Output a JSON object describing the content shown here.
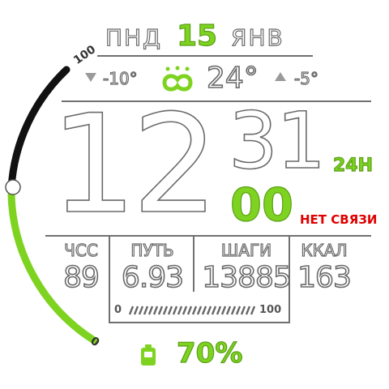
{
  "colors": {
    "accent": "#7ed321",
    "alert": "#e00000",
    "arc_dark": "#111111",
    "outline": "#6a6a6a"
  },
  "date": {
    "day_of_week": "ПНД",
    "day": "15",
    "month": "ЯНВ"
  },
  "weather": {
    "min_icon": "triangle-down-icon",
    "min_temp": "-10°",
    "condition_icon": "cloudy-weather-icon",
    "current_temp": "24°",
    "max_icon": "triangle-up-icon",
    "max_temp": "-5°"
  },
  "time": {
    "hours": "12",
    "minutes": "31",
    "seconds": "00",
    "format": "24H"
  },
  "status": {
    "connection": "НЕТ СВЯЗИ"
  },
  "stats": {
    "heart_rate": {
      "label": "ЧСС",
      "value": "89"
    },
    "distance": {
      "label": "ПУТЬ",
      "value": "6.93"
    },
    "steps": {
      "label": "ШАГИ",
      "value": "13885"
    },
    "calories": {
      "label": "ККАЛ",
      "value": "163"
    }
  },
  "steps_progress": {
    "min_label": "0",
    "max_label": "100",
    "fraction": 1.0
  },
  "gauge": {
    "max_label": "100",
    "min_label": "0",
    "level_fraction": 0.55
  },
  "battery": {
    "icon": "battery-icon",
    "percent": "70%"
  }
}
